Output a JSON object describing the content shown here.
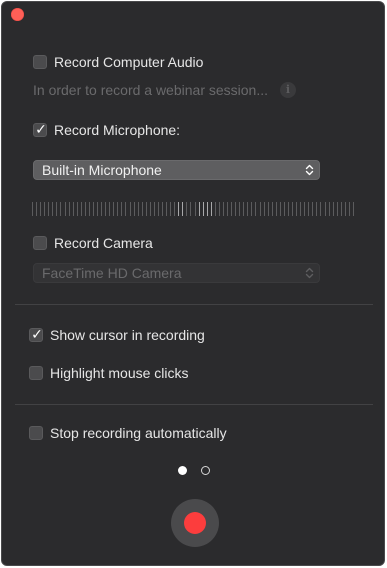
{
  "window": {
    "close_button": "close"
  },
  "options": {
    "record_computer_audio": {
      "label": "Record Computer Audio",
      "checked": false,
      "hint": "In order to record a webinar session..."
    },
    "record_microphone": {
      "label": "Record Microphone:",
      "checked": true,
      "device": "Built-in Microphone"
    },
    "record_camera": {
      "label": "Record Camera",
      "checked": false,
      "device": "FaceTime HD Camera"
    },
    "show_cursor": {
      "label": "Show cursor in recording",
      "checked": true
    },
    "highlight_clicks": {
      "label": "Highlight mouse clicks",
      "checked": false
    },
    "stop_automatically": {
      "label": "Stop recording automatically",
      "checked": false
    }
  },
  "pagination": {
    "total": 2,
    "current": 1
  },
  "icons": {
    "info": "i",
    "check": "✓"
  },
  "colors": {
    "window_bg": "#2b2b2d",
    "close": "#fe5f57",
    "record": "#fc3d3d"
  }
}
